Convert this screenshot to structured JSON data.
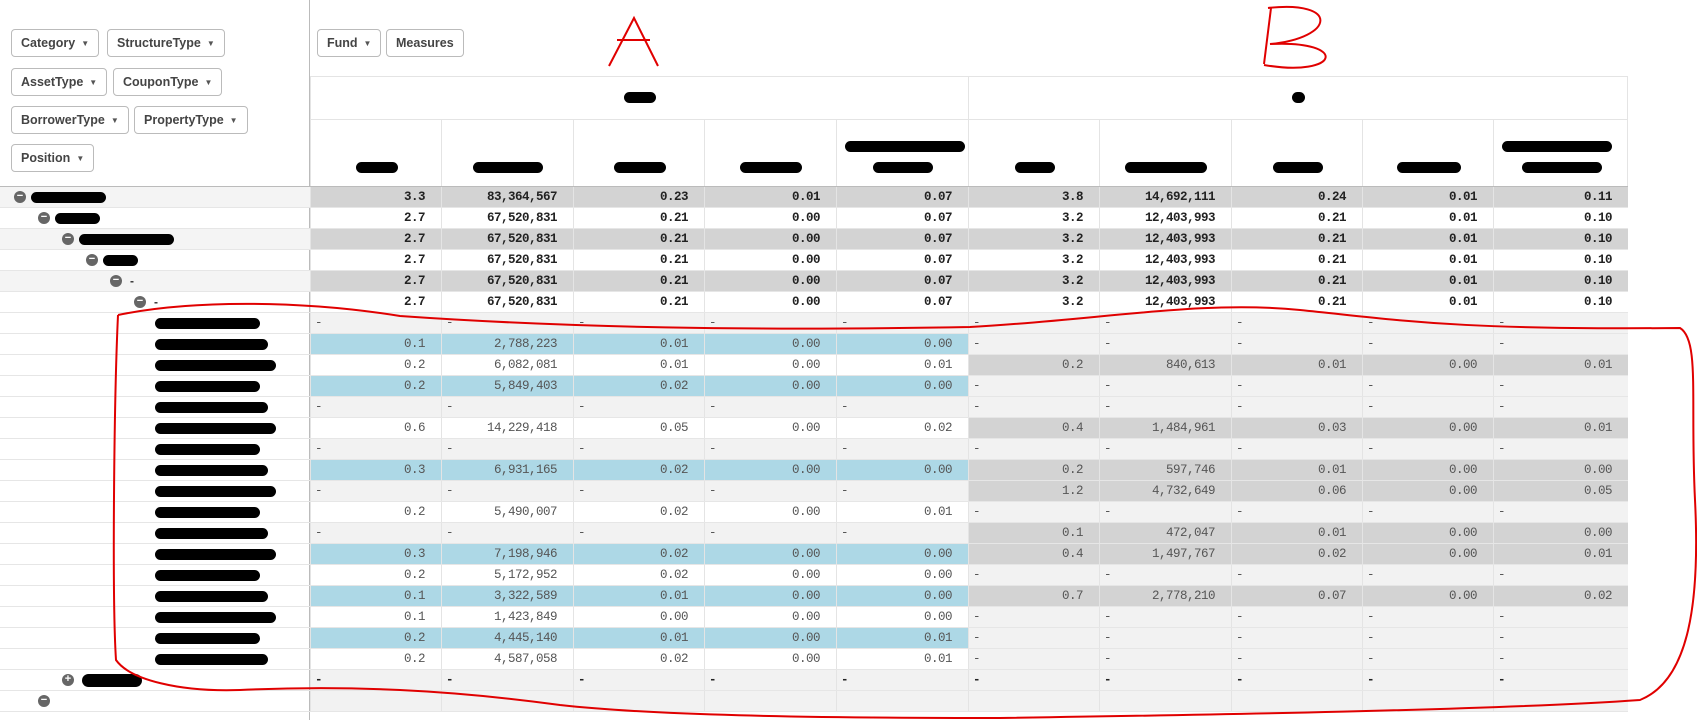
{
  "dimensions": [
    "Category",
    "StructureType",
    "AssetType",
    "CouponType",
    "BorrowerType",
    "PropertyType",
    "Position"
  ],
  "columns_bar": {
    "fund": "Fund",
    "measures": "Measures"
  },
  "annotations": {
    "a": "A",
    "b": "B"
  },
  "colors": {
    "blue": "#add8e6",
    "grey": "#d3d3d3",
    "dash": "#f2f2f2",
    "annotation": "#e00000"
  },
  "total_rows": [
    {
      "level": 0,
      "label": "",
      "a": [
        "3.3",
        "83,364,567",
        "0.23",
        "0.01",
        "0.07"
      ],
      "b": [
        "3.8",
        "14,692,111",
        "0.24",
        "0.01",
        "0.11"
      ],
      "bg": "grey"
    },
    {
      "level": 1,
      "label": "",
      "a": [
        "2.7",
        "67,520,831",
        "0.21",
        "0.00",
        "0.07"
      ],
      "b": [
        "3.2",
        "12,403,993",
        "0.21",
        "0.01",
        "0.10"
      ],
      "bg": "white"
    },
    {
      "level": 2,
      "label": "",
      "a": [
        "2.7",
        "67,520,831",
        "0.21",
        "0.00",
        "0.07"
      ],
      "b": [
        "3.2",
        "12,403,993",
        "0.21",
        "0.01",
        "0.10"
      ],
      "bg": "grey"
    },
    {
      "level": 3,
      "label": "",
      "a": [
        "2.7",
        "67,520,831",
        "0.21",
        "0.00",
        "0.07"
      ],
      "b": [
        "3.2",
        "12,403,993",
        "0.21",
        "0.01",
        "0.10"
      ],
      "bg": "white"
    },
    {
      "level": 4,
      "label": "-",
      "a": [
        "2.7",
        "67,520,831",
        "0.21",
        "0.00",
        "0.07"
      ],
      "b": [
        "3.2",
        "12,403,993",
        "0.21",
        "0.01",
        "0.10"
      ],
      "bg": "grey"
    },
    {
      "level": 5,
      "label": "-",
      "a": [
        "2.7",
        "67,520,831",
        "0.21",
        "0.00",
        "0.07"
      ],
      "b": [
        "3.2",
        "12,403,993",
        "0.21",
        "0.01",
        "0.10"
      ],
      "bg": "white"
    }
  ],
  "detail_rows": [
    {
      "a": null,
      "b": null
    },
    {
      "a": [
        "0.1",
        "2,788,223",
        "0.01",
        "0.00",
        "0.00"
      ],
      "abg": "blue",
      "b": null
    },
    {
      "a": [
        "0.2",
        "6,082,081",
        "0.01",
        "0.00",
        "0.01"
      ],
      "abg": "white",
      "b": [
        "0.2",
        "840,613",
        "0.01",
        "0.00",
        "0.01"
      ]
    },
    {
      "a": [
        "0.2",
        "5,849,403",
        "0.02",
        "0.00",
        "0.00"
      ],
      "abg": "blue",
      "b": null
    },
    {
      "a": null,
      "b": null
    },
    {
      "a": [
        "0.6",
        "14,229,418",
        "0.05",
        "0.00",
        "0.02"
      ],
      "abg": "white",
      "b": [
        "0.4",
        "1,484,961",
        "0.03",
        "0.00",
        "0.01"
      ]
    },
    {
      "a": null,
      "b": null
    },
    {
      "a": [
        "0.3",
        "6,931,165",
        "0.02",
        "0.00",
        "0.00"
      ],
      "abg": "blue",
      "b": [
        "0.2",
        "597,746",
        "0.01",
        "0.00",
        "0.00"
      ]
    },
    {
      "a": null,
      "b": [
        "1.2",
        "4,732,649",
        "0.06",
        "0.00",
        "0.05"
      ]
    },
    {
      "a": [
        "0.2",
        "5,490,007",
        "0.02",
        "0.00",
        "0.01"
      ],
      "abg": "white",
      "b": null
    },
    {
      "a": null,
      "b": [
        "0.1",
        "472,047",
        "0.01",
        "0.00",
        "0.00"
      ]
    },
    {
      "a": [
        "0.3",
        "7,198,946",
        "0.02",
        "0.00",
        "0.00"
      ],
      "abg": "blue",
      "b": [
        "0.4",
        "1,497,767",
        "0.02",
        "0.00",
        "0.01"
      ]
    },
    {
      "a": [
        "0.2",
        "5,172,952",
        "0.02",
        "0.00",
        "0.00"
      ],
      "abg": "white",
      "b": null
    },
    {
      "a": [
        "0.1",
        "3,322,589",
        "0.01",
        "0.00",
        "0.00"
      ],
      "abg": "blue",
      "b": [
        "0.7",
        "2,778,210",
        "0.07",
        "0.00",
        "0.02"
      ]
    },
    {
      "a": [
        "0.1",
        "1,423,849",
        "0.00",
        "0.00",
        "0.00"
      ],
      "abg": "white",
      "b": null
    },
    {
      "a": [
        "0.2",
        "4,445,140",
        "0.01",
        "0.00",
        "0.01"
      ],
      "abg": "blue",
      "b": null
    },
    {
      "a": [
        "0.2",
        "4,587,058",
        "0.02",
        "0.00",
        "0.01"
      ],
      "abg": "white",
      "b": null
    }
  ],
  "dash": "-"
}
